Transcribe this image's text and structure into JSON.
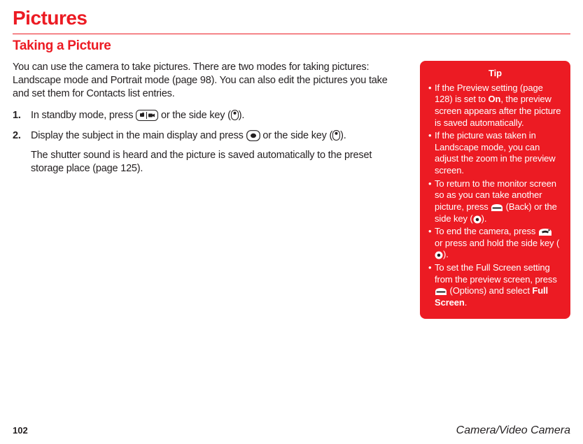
{
  "title": "Pictures",
  "subtitle": "Taking a Picture",
  "intro": "You can use the camera to take pictures. There are two modes for taking pictures: Landscape mode and Portrait mode (page 98). You can also edit the pictures you take and set them for Contacts list entries.",
  "steps": [
    {
      "num": "1.",
      "lines": [
        "In standby mode, press ",
        " or the side key (",
        ")."
      ]
    },
    {
      "num": "2.",
      "lines": [
        "Display the subject in the main display and press ",
        " or the side key (",
        ")."
      ],
      "after": "The shutter sound is heard and the picture is saved automatically to the preset storage place (page 125)."
    }
  ],
  "tip": {
    "heading": "Tip",
    "items": [
      {
        "pre": "If the Preview setting (page 128) is set to ",
        "bold": "On",
        "post": ", the preview screen appears after the picture is saved automatically."
      },
      {
        "pre": "If the picture was taken in Landscape mode, you can adjust the zoom in the preview screen."
      },
      {
        "pre": "To return to the monitor screen so as you can take another picture, press ",
        "icon1": "soft-key-icon",
        "mid": " (Back) or the side key (",
        "icon2": "camera-side-icon",
        "post": ")."
      },
      {
        "pre": "To end the camera, press ",
        "icon1": "end-key-icon",
        "mid": " or press and hold the side key (",
        "icon2": "camera-side-icon",
        "post": ")."
      },
      {
        "pre": "To set the Full Screen setting from the preview screen, press ",
        "icon1": "soft-key-icon",
        "mid": " (Options) and select ",
        "bold": "Full Screen",
        "post": "."
      }
    ]
  },
  "footer": {
    "page": "102",
    "chapter": "Camera/Video Camera"
  }
}
